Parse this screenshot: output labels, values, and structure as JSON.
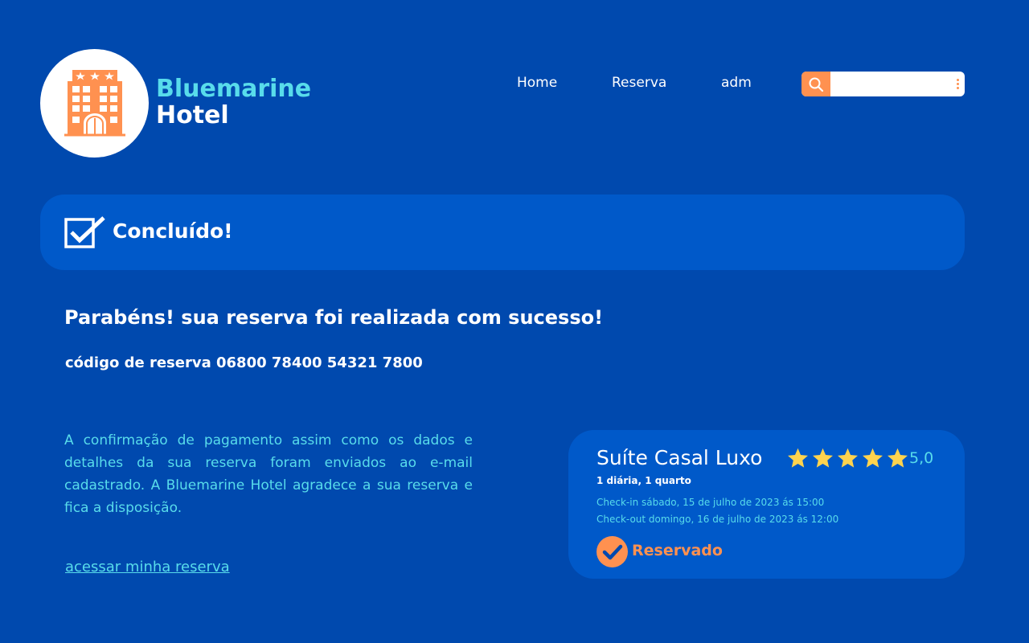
{
  "brand": {
    "line1": "Bluemarine",
    "line2": "Hotel",
    "icon": "hotel-building-icon"
  },
  "nav": [
    {
      "label": "Home"
    },
    {
      "label": "Reserva"
    },
    {
      "label": "adm"
    }
  ],
  "search": {
    "placeholder": "",
    "icon": "search-icon",
    "menu_icon": "kebab-menu-icon"
  },
  "banner": {
    "title": "Concluído!",
    "icon": "checkbox-checked-icon"
  },
  "confirmation": {
    "heading": "Parabéns! sua reserva foi realizada com sucesso!",
    "code_text": "código de reserva 06800 78400 54321 7800",
    "message": "A confirmação de pagamento assim como os dados e detalhes da sua reserva foram enviados ao e-mail cadastrado. A Bluemarine Hotel agradece a sua reserva e fica a disposição.",
    "link": "acessar minha reserva"
  },
  "booking": {
    "room": "Suíte Casal Luxo",
    "stars": 5,
    "rating": "5,0",
    "details": "1 diária, 1 quarto",
    "checkin": "Check-in sábado, 15 de julho de 2023 ás 15:00",
    "checkout": "Check-out domingo, 16 de julho de 2023 ás 12:00",
    "status": "Reservado",
    "status_icon": "check-circle-icon"
  },
  "colors": {
    "background": "#0049AE",
    "panel": "#0059C9",
    "accent": "#FF9150",
    "cyan": "#58DCEB",
    "star": "#FFD34E"
  }
}
